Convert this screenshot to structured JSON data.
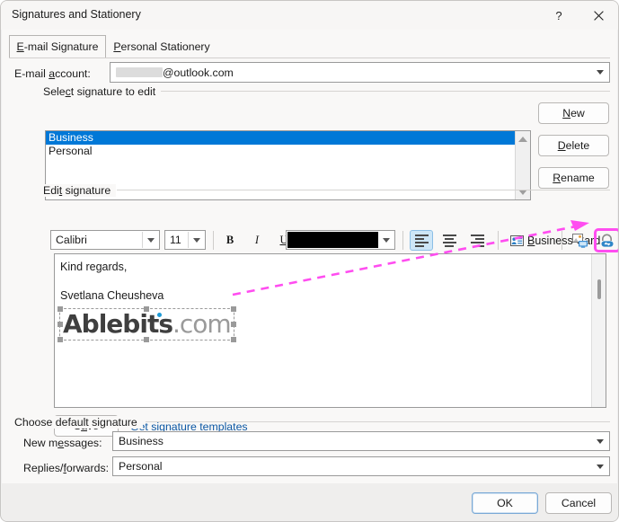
{
  "window": {
    "title": "Signatures and Stationery",
    "help_icon": "question-mark-icon",
    "close_icon": "close-icon"
  },
  "tabs": [
    {
      "label": "E-mail Signature",
      "accel_prefix": "E",
      "selected": true
    },
    {
      "label": "Personal Stationery",
      "accel_prefix": "P",
      "selected": false
    }
  ],
  "account": {
    "label_pre": "E-mail ",
    "label_accel": "a",
    "label_post": "ccount:",
    "value_redacted": true,
    "value_suffix": "@outlook.com"
  },
  "select_group": {
    "title_pre": "Sele",
    "title_accel": "c",
    "title_post": "t signature to edit",
    "items": [
      {
        "label": "Business",
        "selected": true
      },
      {
        "label": "Personal",
        "selected": false
      }
    ]
  },
  "side_buttons": [
    {
      "label_pre": "",
      "accel": "N",
      "label_post": "ew",
      "name": "new-signature-button"
    },
    {
      "label_pre": "",
      "accel": "D",
      "label_post": "elete",
      "name": "delete-signature-button"
    },
    {
      "label_pre": "",
      "accel": "R",
      "label_post": "ename",
      "name": "rename-signature-button"
    }
  ],
  "edit_group": {
    "title_pre": "Edi",
    "title_accel": "t",
    "title_post": " signature"
  },
  "toolbar": {
    "font_family": "Calibri",
    "font_size": "11",
    "bold_label": "B",
    "italic_label": "I",
    "underline_label": "U",
    "font_color": "#000000",
    "align_left_active": true,
    "business_card_pre": "",
    "business_card_accel": "B",
    "business_card_post": "usiness Card",
    "picture_icon": "insert-picture-icon",
    "hyperlink_icon": "insert-hyperlink-icon",
    "hyperlink_highlight_color": "#ff4df0"
  },
  "editor": {
    "lines": [
      "Kind regards,",
      "Svetlana Cheusheva"
    ],
    "logo_bold": "Ablebits",
    "logo_light": ".com"
  },
  "save_button": {
    "label_pre": "S",
    "accel": "a",
    "label_post": "ve"
  },
  "templates_link": "Get signature templates",
  "default_group": {
    "title": "Choose default signature",
    "rows": [
      {
        "label_pre": "New m",
        "label_accel": "e",
        "label_post": "ssages:",
        "value": "Business",
        "name": "new-messages-signature-select"
      },
      {
        "label_pre": "Replies/",
        "label_accel": "f",
        "label_post": "orwards:",
        "value": "Personal",
        "name": "replies-forwards-signature-select"
      }
    ]
  },
  "footer_buttons": [
    {
      "label": "OK",
      "name": "ok-button",
      "default": true
    },
    {
      "label": "Cancel",
      "name": "cancel-button",
      "default": false
    }
  ]
}
